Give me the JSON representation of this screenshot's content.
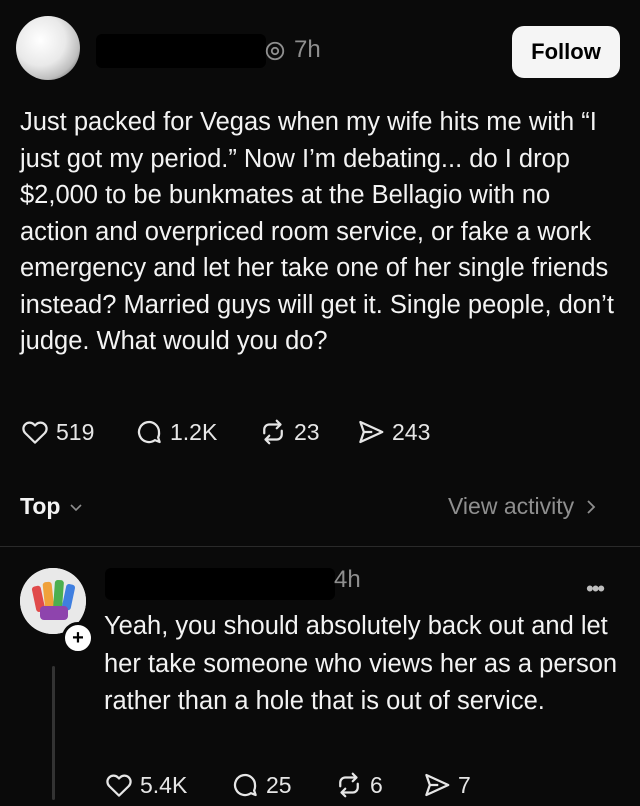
{
  "post": {
    "time": "7h",
    "follow_label": "Follow",
    "text": "Just packed for Vegas when my wife hits me with “I just got my period.” Now I’m debating... do I drop $2,000 to be bunkmates at the Bellagio with no action and overpriced room service, or fake a work emergency and let her take one of her single friends instead? Married guys will get it. Single people, don’t judge. What would you do?",
    "likes": "519",
    "replies": "1.2K",
    "reposts": "23",
    "shares": "243"
  },
  "sort": {
    "label": "Top",
    "view_activity": "View activity"
  },
  "reply": {
    "time": "4h",
    "text": "Yeah, you should absolutely back out and let her take someone who views her as a person rather than a hole that is out of service.",
    "likes": "5.4K",
    "replies": "25",
    "reposts": "6",
    "shares": "7"
  },
  "icons": [
    "heart-icon",
    "comment-icon",
    "repost-icon",
    "share-icon",
    "chevron-down-icon",
    "chevron-right-icon",
    "more-icon",
    "plus-icon"
  ],
  "colors": {
    "background": "#0a0a0a",
    "text": "#f3f3f3",
    "muted": "#8f8f8f",
    "button_bg": "#f5f5f5"
  }
}
